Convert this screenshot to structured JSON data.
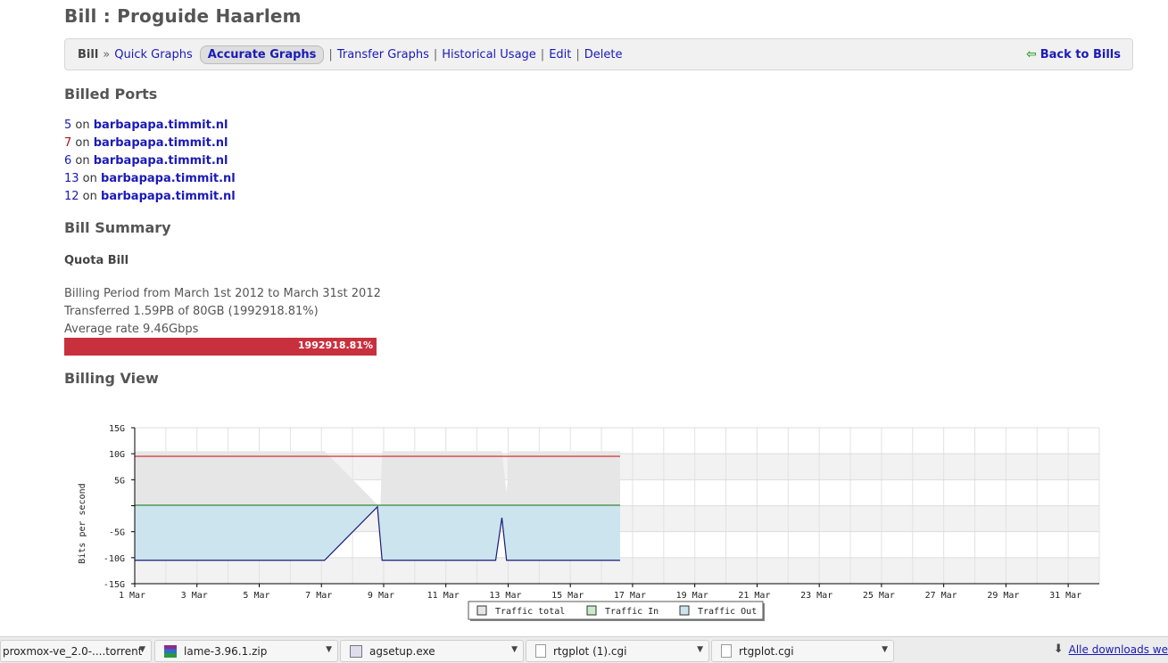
{
  "page": {
    "title": "Bill : Proguide Haarlem"
  },
  "nav": {
    "bill": "Bill",
    "sep": "»",
    "quick_graphs": "Quick Graphs",
    "accurate_graphs": "Accurate Graphs",
    "pipe": "|",
    "transfer_graphs": "Transfer Graphs",
    "historical_usage": "Historical Usage",
    "edit": "Edit",
    "delete": "Delete",
    "back": "Back to Bills",
    "back_icon": "left-arrow-icon"
  },
  "billed_ports": {
    "heading": "Billed Ports",
    "on_word": "on",
    "items": [
      {
        "port": "5",
        "host": "barbapapa.timmit.nl",
        "color": "#1a1ab8"
      },
      {
        "port": "7",
        "host": "barbapapa.timmit.nl",
        "color": "#b01010"
      },
      {
        "port": "6",
        "host": "barbapapa.timmit.nl",
        "color": "#1a1ab8"
      },
      {
        "port": "13",
        "host": "barbapapa.timmit.nl",
        "color": "#1a1ab8"
      },
      {
        "port": "12",
        "host": "barbapapa.timmit.nl",
        "color": "#1a1ab8"
      }
    ]
  },
  "summary": {
    "heading": "Bill Summary",
    "quota_label": "Quota Bill",
    "period": "Billing Period from March 1st 2012 to March 31st 2012",
    "transferred": "Transferred 1.59PB of 80GB (1992918.81%)",
    "average": "Average rate 9.46Gbps",
    "bar_label": "1992918.81%",
    "bar_color": "#c8303e"
  },
  "billing_view": {
    "heading": "Billing View"
  },
  "chart_data": {
    "type": "area",
    "ylabel": "Bits per second",
    "ytick_labels": [
      "15G",
      "10G",
      "5G",
      "",
      "-5G",
      "-10G",
      "-15G"
    ],
    "yticks": [
      15,
      10,
      5,
      0,
      -5,
      -10,
      -15
    ],
    "ylim": [
      -15,
      15
    ],
    "xtick_labels": [
      "1 Mar",
      "3 Mar",
      "5 Mar",
      "7 Mar",
      "9 Mar",
      "11 Mar",
      "13 Mar",
      "15 Mar",
      "17 Mar",
      "19 Mar",
      "21 Mar",
      "23 Mar",
      "25 Mar",
      "27 Mar",
      "29 Mar",
      "31 Mar"
    ],
    "xticks": [
      1,
      3,
      5,
      7,
      9,
      11,
      13,
      15,
      17,
      19,
      21,
      23,
      25,
      27,
      29,
      31
    ],
    "xlim": [
      1,
      32
    ],
    "grid": true,
    "legend_position": "bottom",
    "series": [
      {
        "name": "Traffic total",
        "color": "#e6e6e6",
        "points": [
          [
            1,
            10.5
          ],
          [
            7.1,
            10.5
          ],
          [
            8.8,
            0.2
          ],
          [
            8.9,
            0.2
          ],
          [
            8.95,
            10.5
          ],
          [
            12.8,
            10.5
          ],
          [
            12.95,
            2.5
          ],
          [
            13.05,
            10.5
          ],
          [
            16.6,
            10.5
          ]
        ]
      },
      {
        "name": "Traffic In",
        "color": "#c8ecc8",
        "points": [
          [
            1,
            0.1
          ],
          [
            16.6,
            0.1
          ]
        ]
      },
      {
        "name": "Traffic Out",
        "color": "#cce4ee",
        "points": [
          [
            1,
            -10.5
          ],
          [
            7.1,
            -10.5
          ],
          [
            8.8,
            -0.2
          ],
          [
            8.95,
            -10.5
          ],
          [
            12.6,
            -10.5
          ],
          [
            12.8,
            -2.3
          ],
          [
            12.95,
            -10.5
          ],
          [
            16.6,
            -10.5
          ]
        ]
      }
    ],
    "reference_lines": [
      {
        "y": 9.5,
        "color": "#d02020"
      },
      {
        "y": 0.1,
        "color": "#208020"
      }
    ]
  },
  "downloads": {
    "items": [
      {
        "name": "proxmox-ve_2.0-....torrent",
        "icon": "torrent-file-icon"
      },
      {
        "name": "lame-3.96.1.zip",
        "icon": "winrar-archive-icon"
      },
      {
        "name": "agsetup.exe",
        "icon": "installer-exe-icon"
      },
      {
        "name": "rtgplot (1).cgi",
        "icon": "document-file-icon"
      },
      {
        "name": "rtgplot.cgi",
        "icon": "document-file-icon"
      }
    ],
    "all": "Alle downloads we"
  }
}
